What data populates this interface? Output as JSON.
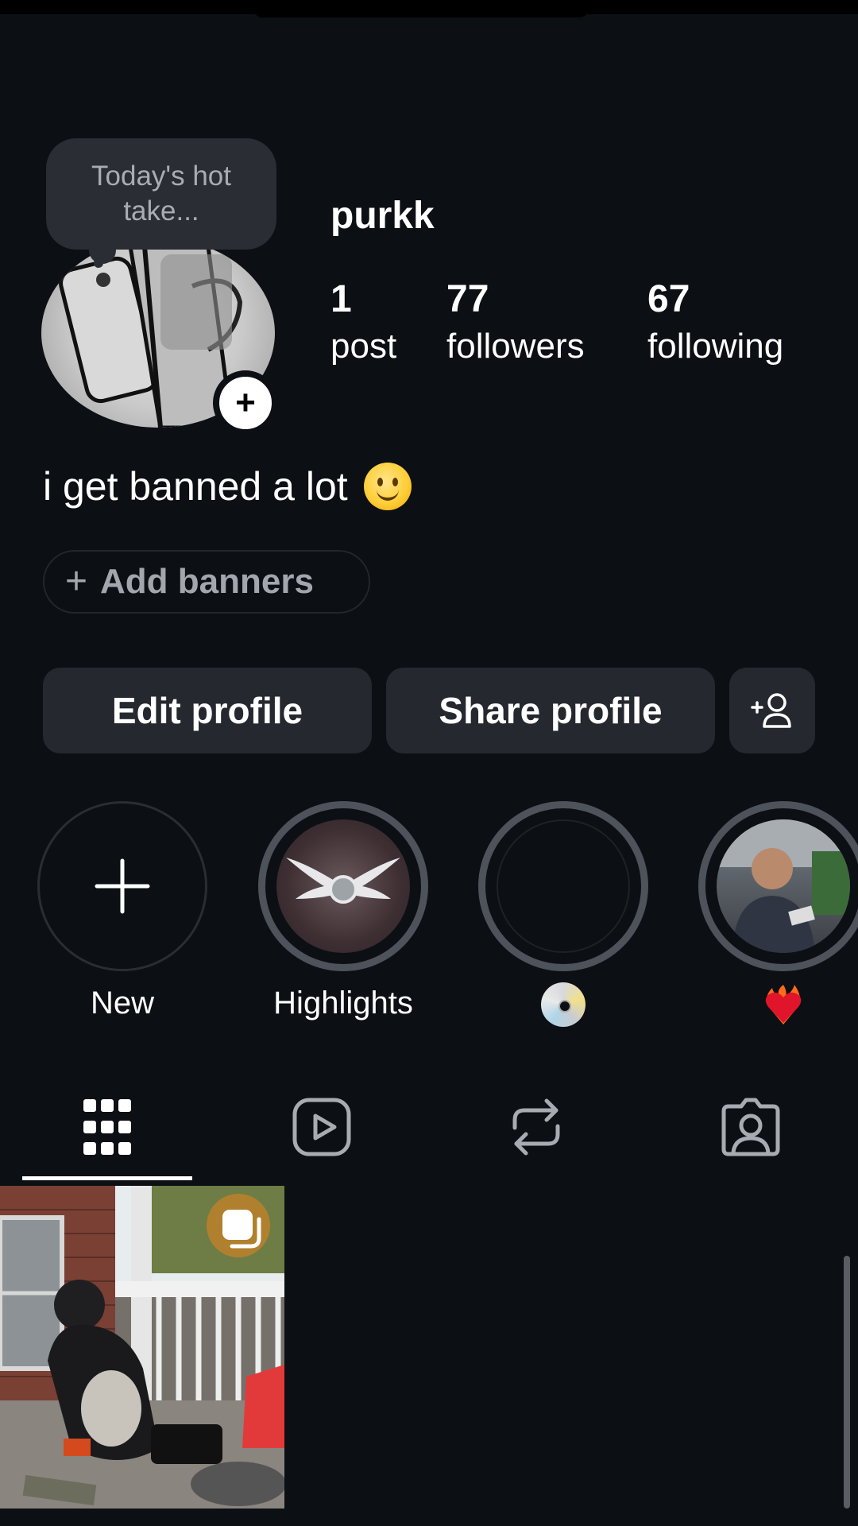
{
  "note": {
    "text": "Today's hot take..."
  },
  "profile": {
    "username": "purkk",
    "stats": [
      {
        "value": "1",
        "label": "post"
      },
      {
        "value": "77",
        "label": "followers"
      },
      {
        "value": "67",
        "label": "following"
      }
    ],
    "bio": "i get banned a lot"
  },
  "banners": {
    "label": "Add banners"
  },
  "actions": {
    "edit": "Edit profile",
    "share": "Share profile"
  },
  "highlights": [
    {
      "label": "New"
    },
    {
      "label": "Highlights"
    },
    {
      "label": ""
    },
    {
      "label": ""
    }
  ],
  "tabs": [
    {
      "icon": "grid-icon",
      "active": true
    },
    {
      "icon": "reels-icon",
      "active": false
    },
    {
      "icon": "reposts-icon",
      "active": false
    },
    {
      "icon": "tagged-icon",
      "active": false
    }
  ],
  "icons": {
    "avatar": "phone-sticker-avatar",
    "add_story": "plus-icon",
    "add_person": "add-person-icon",
    "highlight_3_emoji": "disc-icon",
    "highlight_4_emoji": "heart-on-fire-icon",
    "post_badge": "carousel-icon"
  },
  "colors": {
    "background": "#0c0f14",
    "button": "#25282e",
    "ring": "#4e525a"
  }
}
